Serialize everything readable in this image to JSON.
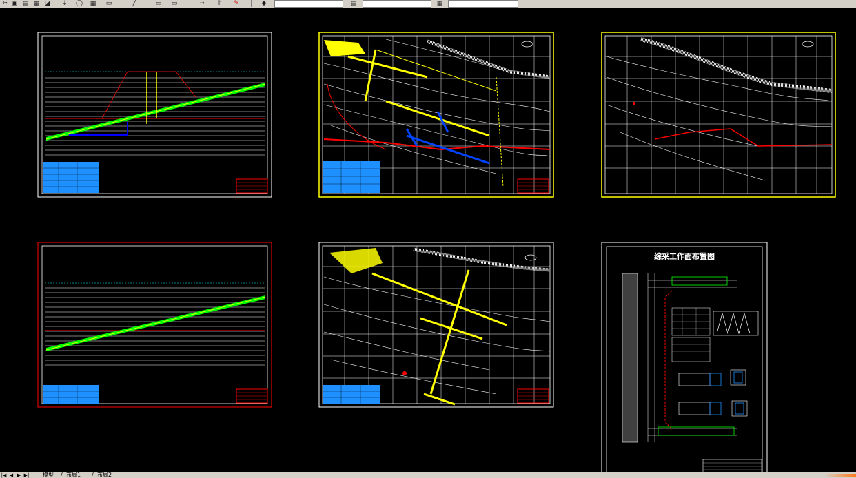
{
  "toolbar": {
    "icons": [
      "pan-icon",
      "copy-icon",
      "arrow-down-icon",
      "circle-icon",
      "properties-icon",
      "match-icon",
      "line-icon",
      "layer-icon",
      "paint-icon"
    ],
    "layer_value": "",
    "style_value": ""
  },
  "sheets": [
    {
      "id": "sheet-profile-1",
      "type": "section",
      "border": "#ffffff"
    },
    {
      "id": "sheet-plan-1",
      "type": "plan",
      "border": "#ffff00"
    },
    {
      "id": "sheet-plan-2",
      "type": "plan",
      "border": "#ffff00"
    },
    {
      "id": "sheet-profile-2",
      "type": "section",
      "border": "#ff0000"
    },
    {
      "id": "sheet-plan-3",
      "type": "plan",
      "border": "#ffffff"
    },
    {
      "id": "sheet-layout",
      "type": "layout",
      "border": "#ffffff",
      "title": "综采工作面布置图"
    }
  ],
  "statusbar": {
    "tabs": [
      "模型",
      "布局1",
      "布局2"
    ],
    "separator": "/"
  },
  "colors": {
    "background": "#000000",
    "grid": "#ffffff",
    "seam": "#00ff00",
    "road": "#ffff00",
    "fault": "#ff0000",
    "water": "#00ffff",
    "table": "#1e90ff"
  }
}
